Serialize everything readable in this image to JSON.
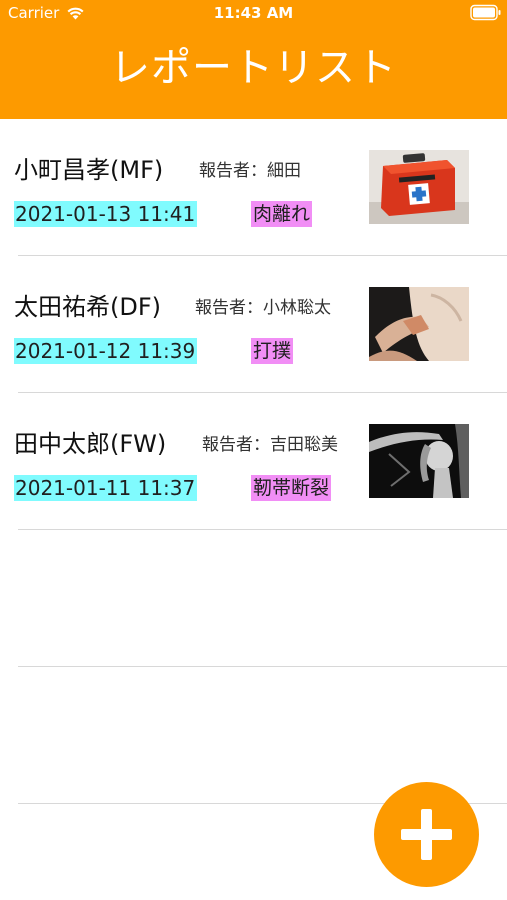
{
  "status_bar": {
    "carrier": "Carrier",
    "time": "11:43 AM"
  },
  "header": {
    "title": "レポートリスト"
  },
  "reports": [
    {
      "player": "小町昌孝(MF)",
      "reporter": "報告者：細田",
      "datetime": "2021-01-13 11:41",
      "injury": "肉離れ",
      "thumbnail": "first-aid-kit-photo"
    },
    {
      "player": "太田祐希(DF)",
      "reporter": "報告者：小林聡太",
      "datetime": "2021-01-12 11:39",
      "injury": "打撲",
      "thumbnail": "bandaged-finger-photo"
    },
    {
      "player": "田中太郎(FW)",
      "reporter": "報告者：吉田聡美",
      "datetime": "2021-01-11 11:37",
      "injury": "靭帯断裂",
      "thumbnail": "shoulder-xray-photo"
    }
  ],
  "fab": {
    "icon": "plus-icon"
  },
  "colors": {
    "header": "#fd9a00",
    "datetime_highlight": "#80fbfe",
    "injury_highlight": "#f18ef5",
    "fab": "#fd9a00"
  }
}
